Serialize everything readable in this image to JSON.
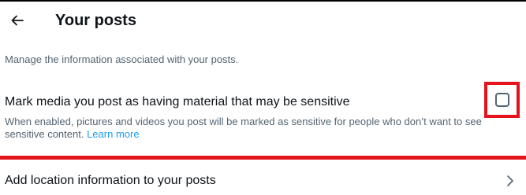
{
  "header": {
    "title": "Your posts"
  },
  "description": "Manage the information associated with your posts.",
  "sensitive_media": {
    "title": "Mark media you post as having material that may be sensitive",
    "description": "When enabled, pictures and videos you post will be marked as sensitive for people who don’t want to see sensitive content.",
    "learn_more": "Learn more",
    "checked": false
  },
  "location": {
    "label": "Add location information to your posts"
  },
  "colors": {
    "highlight": "#e5141c",
    "link": "#1d9bf0",
    "secondary_text": "#536471",
    "primary_text": "#0f1419"
  },
  "icons": {
    "back": "arrow-left-icon",
    "chevron": "chevron-right-icon"
  }
}
